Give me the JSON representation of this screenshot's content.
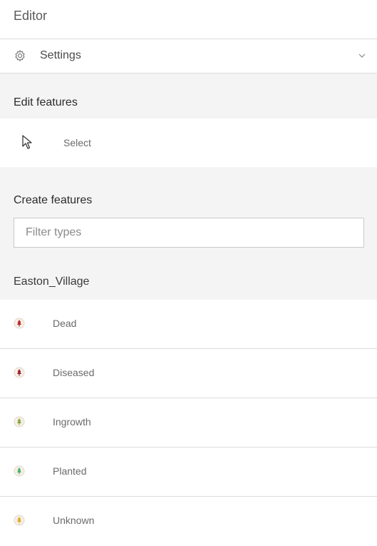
{
  "editor": {
    "title": "Editor"
  },
  "settings": {
    "label": "Settings",
    "icon": "gear-icon",
    "expand_icon": "chevron-down-icon"
  },
  "edit_features": {
    "heading": "Edit features",
    "select_label": "Select",
    "select_icon": "cursor-arrow-icon"
  },
  "create_features": {
    "heading": "Create features",
    "filter_placeholder": "Filter types",
    "filter_value": "",
    "layer_name": "Easton_Village",
    "items": [
      {
        "label": "Dead",
        "icon": "tree-symbol-icon",
        "color": "#b8242a"
      },
      {
        "label": "Diseased",
        "icon": "tree-symbol-icon",
        "color": "#9c1f2e"
      },
      {
        "label": "Ingrowth",
        "icon": "tree-symbol-icon",
        "color": "#8aa63a"
      },
      {
        "label": "Planted",
        "icon": "tree-symbol-icon",
        "color": "#4db06a"
      },
      {
        "label": "Unknown",
        "icon": "tree-symbol-icon",
        "color": "#e0a82e"
      }
    ]
  }
}
